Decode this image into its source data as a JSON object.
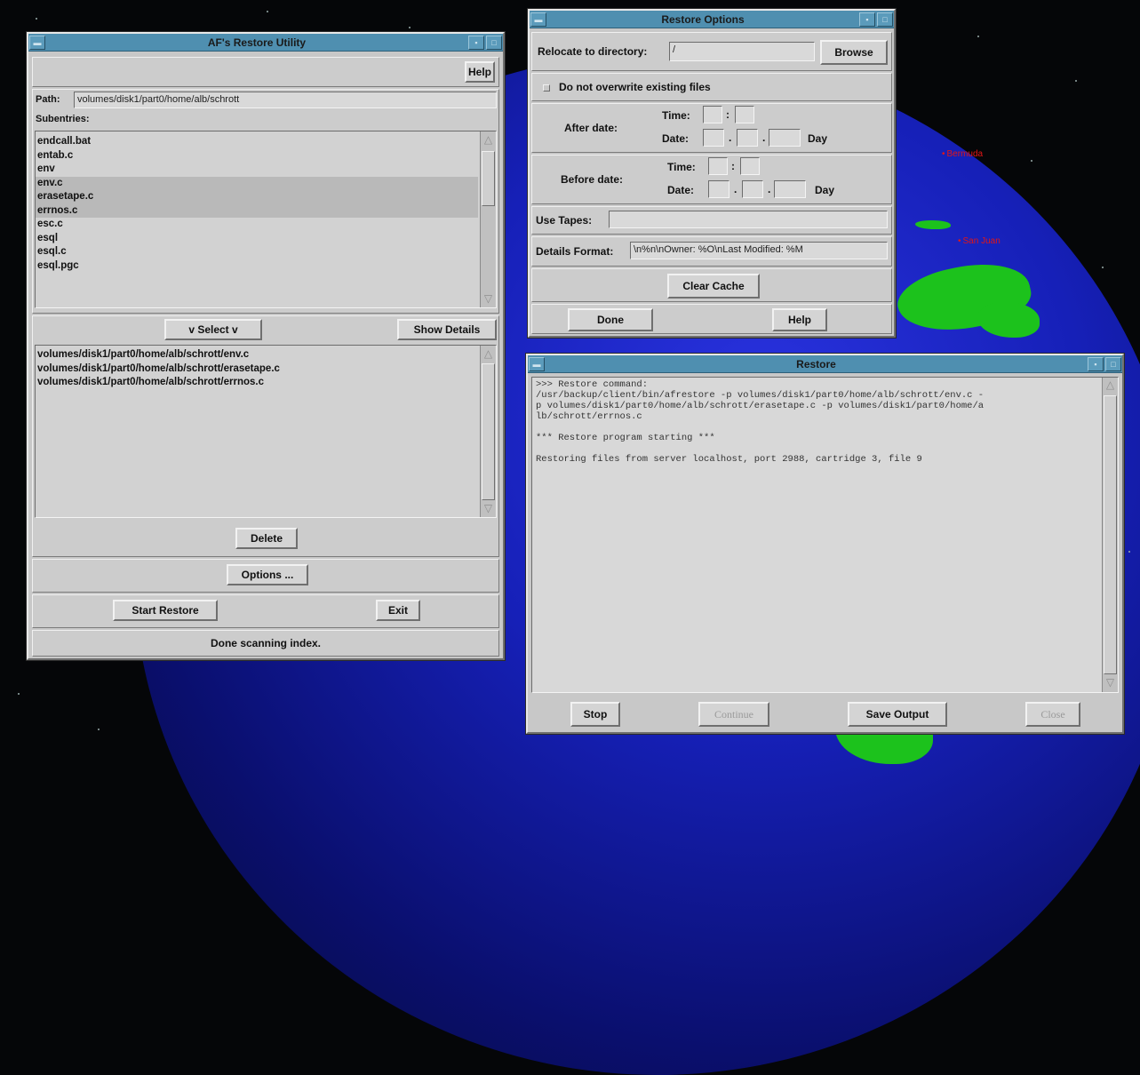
{
  "desktop": {
    "places": [
      "Bermuda",
      "San Juan"
    ]
  },
  "restore_utility": {
    "title": "AF's Restore Utility",
    "help_label": "Help",
    "path_label": "Path:",
    "path_value": "volumes/disk1/part0/home/alb/schrott",
    "subentries_label": "Subentries:",
    "subentries": [
      {
        "name": "endcall.bat",
        "selected": false
      },
      {
        "name": "entab.c",
        "selected": false
      },
      {
        "name": "env",
        "selected": false
      },
      {
        "name": "env.c",
        "selected": true
      },
      {
        "name": "erasetape.c",
        "selected": true
      },
      {
        "name": "errnos.c",
        "selected": true
      },
      {
        "name": "esc.c",
        "selected": false
      },
      {
        "name": "esql",
        "selected": false
      },
      {
        "name": "esql.c",
        "selected": false
      },
      {
        "name": "esql.pgc",
        "selected": false
      }
    ],
    "select_label": "v Select v",
    "show_details_label": "Show Details",
    "selected_paths": [
      "volumes/disk1/part0/home/alb/schrott/env.c",
      "volumes/disk1/part0/home/alb/schrott/erasetape.c",
      "volumes/disk1/part0/home/alb/schrott/errnos.c"
    ],
    "delete_label": "Delete",
    "options_label": "Options ...",
    "start_restore_label": "Start Restore",
    "exit_label": "Exit",
    "status": "Done scanning index."
  },
  "restore_options": {
    "title": "Restore Options",
    "relocate_label": "Relocate to directory:",
    "relocate_value": "/",
    "browse_label": "Browse",
    "no_overwrite_label": "Do not overwrite existing files",
    "no_overwrite_checked": false,
    "after_date_label": "After date:",
    "before_date_label": "Before date:",
    "time_label": "Time:",
    "date_label": "Date:",
    "colon": ":",
    "dot": ".",
    "day_label": "Day",
    "use_tapes_label": "Use Tapes:",
    "use_tapes_value": "",
    "details_format_label": "Details Format:",
    "details_format_value": "\\n%n\\nOwner:        %O\\nLast Modified: %M",
    "clear_cache_label": "Clear Cache",
    "done_label": "Done",
    "help_label": "Help"
  },
  "restore_window": {
    "title": "Restore",
    "output_lines": [
      ">>> Restore command:",
      "/usr/backup/client/bin/afrestore -p volumes/disk1/part0/home/alb/schrott/env.c -",
      "p volumes/disk1/part0/home/alb/schrott/erasetape.c -p volumes/disk1/part0/home/a",
      "lb/schrott/errnos.c",
      "",
      "*** Restore program starting ***",
      "",
      "Restoring files from server localhost, port 2988, cartridge 3, file 9"
    ],
    "stop_label": "Stop",
    "continue_label": "Continue",
    "save_output_label": "Save Output",
    "close_label": "Close"
  }
}
